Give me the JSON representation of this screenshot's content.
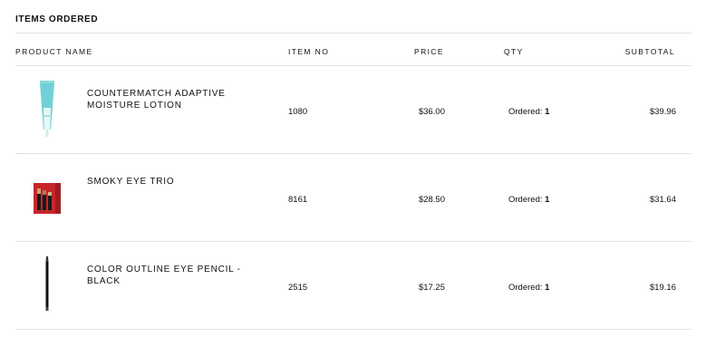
{
  "section": {
    "title": "ITEMS ORDERED"
  },
  "table": {
    "headers": {
      "product_name": "PRODUCT NAME",
      "item_no": "ITEM NO",
      "price": "PRICE",
      "qty": "QTY",
      "subtotal": "SUBTOTAL"
    },
    "rows": [
      {
        "product_name": "COUNTERMATCH ADAPTIVE MOISTURE LOTION",
        "item_no": "1080",
        "price": "$36.00",
        "qty_label": "Ordered:",
        "qty_value": "1",
        "subtotal": "$39.96",
        "thumb_icon": "lotion-tube-icon"
      },
      {
        "product_name": "SMOKY EYE TRIO",
        "item_no": "8161",
        "price": "$28.50",
        "qty_label": "Ordered:",
        "qty_value": "1",
        "subtotal": "$31.64",
        "thumb_icon": "eye-trio-box-icon"
      },
      {
        "product_name": "COLOR OUTLINE EYE PENCIL - BLACK",
        "item_no": "2515",
        "price": "$17.25",
        "qty_label": "Ordered:",
        "qty_value": "1",
        "subtotal": "$19.16",
        "thumb_icon": "eye-pencil-icon"
      }
    ]
  },
  "colors": {
    "divider": "#e2e2e2",
    "text": "#111111",
    "lotion": "#6fd1d6",
    "box_red": "#c7262a"
  }
}
